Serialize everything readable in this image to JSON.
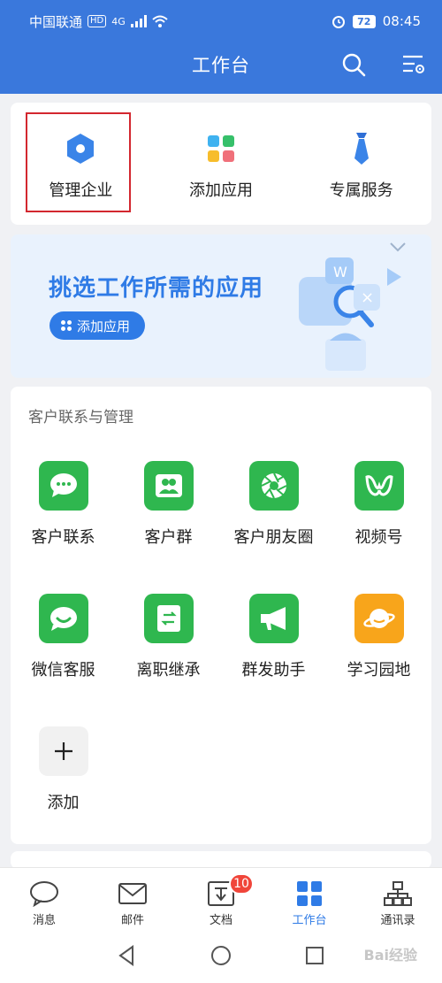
{
  "statusbar": {
    "carrier": "中国联通",
    "hd": "HD",
    "network": "4G",
    "battery": "72",
    "time": "08:45"
  },
  "header": {
    "title": "工作台",
    "search_icon": "search-icon",
    "settings_icon": "settings-icon"
  },
  "top_actions": [
    {
      "label": "管理企业",
      "icon": "hexagon-icon"
    },
    {
      "label": "添加应用",
      "icon": "grid-icon"
    },
    {
      "label": "专属服务",
      "icon": "tie-icon"
    }
  ],
  "banner": {
    "title": "挑选工作所需的应用",
    "button_label": "添加应用"
  },
  "apps_section": {
    "title": "客户联系与管理",
    "apps": [
      {
        "label": "客户联系",
        "color": "#2fb74f",
        "icon": "chat-bubble-icon"
      },
      {
        "label": "客户群",
        "color": "#2fb74f",
        "icon": "group-icon"
      },
      {
        "label": "客户朋友圈",
        "color": "#2fb74f",
        "icon": "aperture-icon"
      },
      {
        "label": "视频号",
        "color": "#2fb74f",
        "icon": "channels-icon"
      },
      {
        "label": "微信客服",
        "color": "#2fb74f",
        "icon": "service-chat-icon"
      },
      {
        "label": "离职继承",
        "color": "#2fb74f",
        "icon": "transfer-icon"
      },
      {
        "label": "群发助手",
        "color": "#2fb74f",
        "icon": "megaphone-icon"
      },
      {
        "label": "学习园地",
        "color": "#f8a51b",
        "icon": "planet-icon"
      },
      {
        "label": "添加",
        "color": "#f1f1f1",
        "icon": "plus-icon"
      }
    ]
  },
  "bottom_nav": [
    {
      "label": "消息",
      "icon": "message-icon"
    },
    {
      "label": "邮件",
      "icon": "mail-icon"
    },
    {
      "label": "文档",
      "icon": "document-icon",
      "badge": "10"
    },
    {
      "label": "工作台",
      "icon": "workbench-icon",
      "active": true
    },
    {
      "label": "通讯录",
      "icon": "contacts-icon"
    }
  ],
  "watermark": "Bai经验",
  "colors": {
    "primary": "#3a78dc",
    "accent": "#2f7be6",
    "green": "#2fb74f",
    "highlight": "#d3272f",
    "badge": "#f0453a"
  }
}
